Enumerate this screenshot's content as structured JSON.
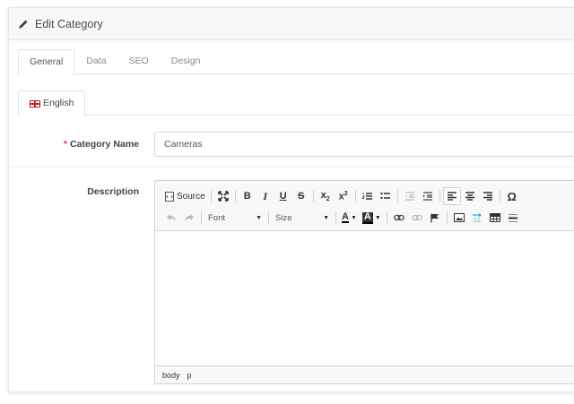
{
  "header": {
    "title": "Edit Category"
  },
  "tabs": [
    {
      "label": "General",
      "active": true
    },
    {
      "label": "Data",
      "active": false
    },
    {
      "label": "SEO",
      "active": false
    },
    {
      "label": "Design",
      "active": false
    }
  ],
  "language_tab": {
    "label": "English"
  },
  "form": {
    "category_name": {
      "required_mark": "*",
      "label": "Category Name",
      "value": "Cameras"
    },
    "description": {
      "label": "Description"
    }
  },
  "editor": {
    "toolbar": {
      "source_label": "Source",
      "font_combo": "Font",
      "size_combo": "Size"
    },
    "status_path": [
      "body",
      "p"
    ]
  },
  "icons": {
    "header": "pencil-icon",
    "source": "source-icon",
    "maximize": "maximize-icon",
    "text_color": "text-color-icon",
    "bg_color": "background-color-icon"
  },
  "colors": {
    "required": "#dd3333",
    "accent_link": "#2aa7e0"
  }
}
